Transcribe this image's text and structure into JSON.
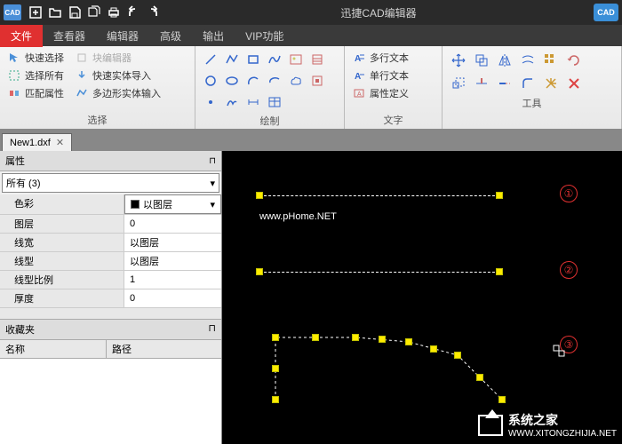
{
  "title": "迅捷CAD编辑器",
  "cad_badge": "CAD",
  "menu": {
    "tabs": [
      "文件",
      "查看器",
      "编辑器",
      "高级",
      "输出",
      "VIP功能"
    ],
    "active_index": 0
  },
  "ribbon": {
    "select": {
      "label": "选择",
      "quick_select": "快速选择",
      "block_editor": "块编辑器",
      "select_all": "选择所有",
      "quick_entity_import": "快速实体导入",
      "match_props": "匹配属性",
      "polyline_entity_input": "多边形实体输入"
    },
    "draw": {
      "label": "绘制"
    },
    "text": {
      "label": "文字",
      "multiline": "多行文本",
      "singleline": "单行文本",
      "attrdef": "属性定义"
    },
    "tools": {
      "label": "工具"
    }
  },
  "doc_tab": {
    "name": "New1.dxf"
  },
  "props": {
    "header": "属性",
    "filter": "所有 (3)",
    "rows": [
      {
        "k": "色彩",
        "v": "以图层",
        "swatch": true,
        "dropdown": true
      },
      {
        "k": "图层",
        "v": "0"
      },
      {
        "k": "线宽",
        "v": "以图层"
      },
      {
        "k": "线型",
        "v": "以图层"
      },
      {
        "k": "线型比例",
        "v": "1"
      },
      {
        "k": "厚度",
        "v": "0"
      }
    ],
    "favorites_header": "收藏夹",
    "fav_cols": [
      "名称",
      "路径"
    ]
  },
  "canvas": {
    "phome": "www.pHome.NET",
    "numbers": [
      "①",
      "②",
      "③"
    ],
    "watermark_title": "系统之家",
    "watermark_url": "WWW.XITONGZHIJIA.NET"
  }
}
